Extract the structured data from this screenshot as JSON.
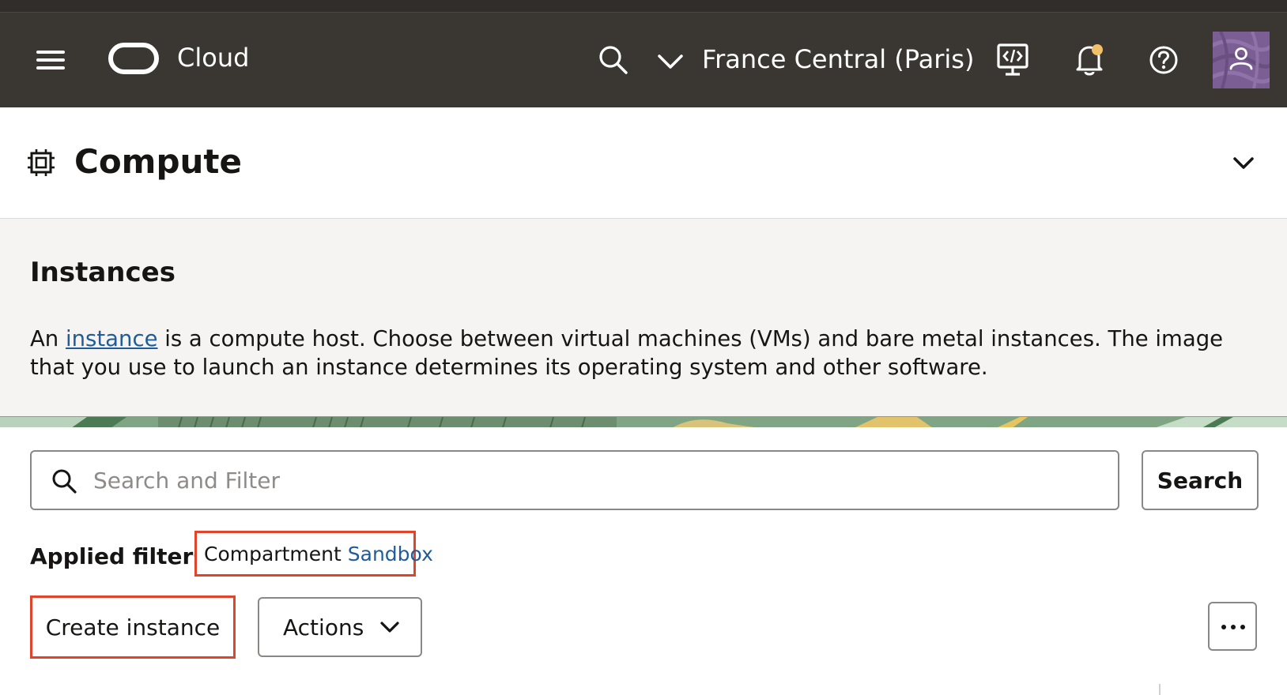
{
  "header": {
    "brand_text": "Cloud",
    "region": "France Central (Paris)",
    "icons": [
      "hamburger-menu-icon",
      "oracle-logo",
      "search-icon",
      "chevron-down-icon",
      "developer-tools-icon",
      "notification-bell-icon",
      "help-icon",
      "user-avatar-icon"
    ],
    "background_color": "#3a3631",
    "notification_dot_color": "#f0c06a"
  },
  "page": {
    "title": "Compute",
    "title_icon": "compute-chip-icon"
  },
  "intro": {
    "heading": "Instances",
    "text_before_link": "An ",
    "link_text": "instance",
    "text_after_link": " is a compute host. Choose between virtual machines (VMs) and bare metal instances. The image that you use to launch an instance determines its operating system and other software.",
    "link_color": "#1f5c99"
  },
  "search": {
    "placeholder": "Search and Filter",
    "value": "",
    "button_label": "Search"
  },
  "filters": {
    "label": "Applied filters",
    "chips": [
      {
        "key": "Compartment",
        "value": "Sandbox"
      }
    ]
  },
  "toolbar": {
    "create_label": "Create instance",
    "actions_label": "Actions",
    "highlight_color": "#e0452b"
  }
}
